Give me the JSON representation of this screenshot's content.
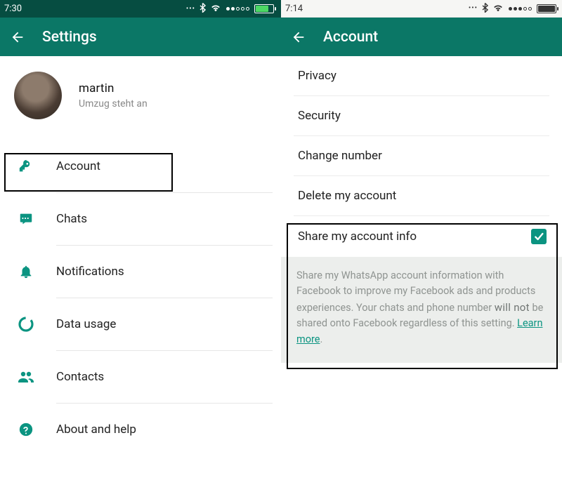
{
  "left": {
    "time": "7:30",
    "title": "Settings",
    "profile": {
      "name": "martin",
      "status": "Umzug steht an"
    },
    "menu": {
      "account": "Account",
      "chats": "Chats",
      "notifications": "Notifications",
      "data_usage": "Data usage",
      "contacts": "Contacts",
      "about": "About and help"
    }
  },
  "right": {
    "time": "7:14",
    "title": "Account",
    "menu": {
      "privacy": "Privacy",
      "security": "Security",
      "change_number": "Change number",
      "delete_account": "Delete my account",
      "share_info": "Share my account info",
      "share_checked": true
    },
    "share_desc": {
      "part1": "Share my WhatsApp account information with Facebook to improve my Facebook ads and products experiences. Your chats and phone number ",
      "emph": "will  not",
      "part2": " be shared onto Facebook regardless of this setting. ",
      "learn_more": "Learn more"
    }
  },
  "colors": {
    "brand": "#0b7766",
    "accent": "#0b9481"
  }
}
